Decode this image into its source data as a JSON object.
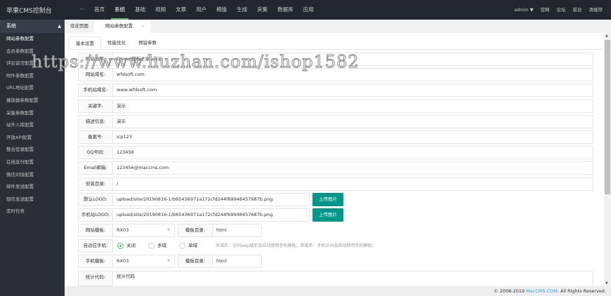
{
  "app_title": "苹果CMS控制台",
  "nav": [
    "···",
    "首页",
    "系统",
    "基础",
    "视频",
    "文章",
    "用户",
    "模版",
    "生成",
    "采集",
    "数据库",
    "应用"
  ],
  "user": "admin",
  "top_links": [
    "官网",
    "论坛",
    "前台",
    "清缓存"
  ],
  "sidebar": {
    "header": "系统",
    "items": [
      "网站参数配置",
      "会员参数配置",
      "评论留言配置",
      "附件参数配置",
      "URL地址配置",
      "播放器参数配置",
      "采集参数配置",
      "站外入库配置",
      "开放API配置",
      "整合登录配置",
      "在线支付配置",
      "微信对接配置",
      "邮件发送配置",
      "短信发送配置",
      "定时任务"
    ]
  },
  "tabs": [
    "欢迎页面",
    "网站参数配置"
  ],
  "subtabs": [
    "基本设置",
    "性能优化",
    "预留参数"
  ],
  "fields": [
    {
      "label": "网站名称:",
      "value": "Discuz模板之家--演示"
    },
    {
      "label": "网站域名:",
      "value": "wfdsoft.com"
    },
    {
      "label": "手机站域名:",
      "value": "www.wfdsoft.com"
    },
    {
      "label": "关键字:",
      "value": "演示"
    },
    {
      "label": "描述信息:",
      "value": "演示"
    },
    {
      "label": "备案号:",
      "value": "icp123"
    },
    {
      "label": "QQ号码:",
      "value": "123456"
    },
    {
      "label": "Email邮箱:",
      "value": "123456@maccms.com"
    },
    {
      "label": "安装目录:",
      "value": "/"
    },
    {
      "label": "默认LOGO:",
      "value": "upload/site/20190816-1/b65436971a172cfd244f69948457687b.png"
    },
    {
      "label": "手机站LOGO:",
      "value": "upload/site/20190816-1/b65436971a172cfd244f69948457687b.png"
    }
  ],
  "upload_label": "上传图片",
  "template": {
    "label": "网站模板:",
    "value": "RX03",
    "dir_label": "模板目录:",
    "dir_value": "html"
  },
  "adapt": {
    "label": "自适应手机:",
    "options": [
      "关闭",
      "多域",
      "单域"
    ],
    "selected": "关闭",
    "hint": "多域名：访问wap域名会自动使用手机模板；单域名：手机访问会自动使用手机模板；"
  },
  "mobile_template": {
    "label": "手机模板:",
    "value": "RX03",
    "dir_label": "模板目录:",
    "dir_value": "html"
  },
  "stats": {
    "label": "统计代码:",
    "value": "统计代码"
  },
  "footer": {
    "pre": "© 2008-2019 ",
    "link": "MacCMS.COM",
    "post": ". All Rights Reserved."
  },
  "watermark": "https://www.huzhan.com/ishop1582"
}
